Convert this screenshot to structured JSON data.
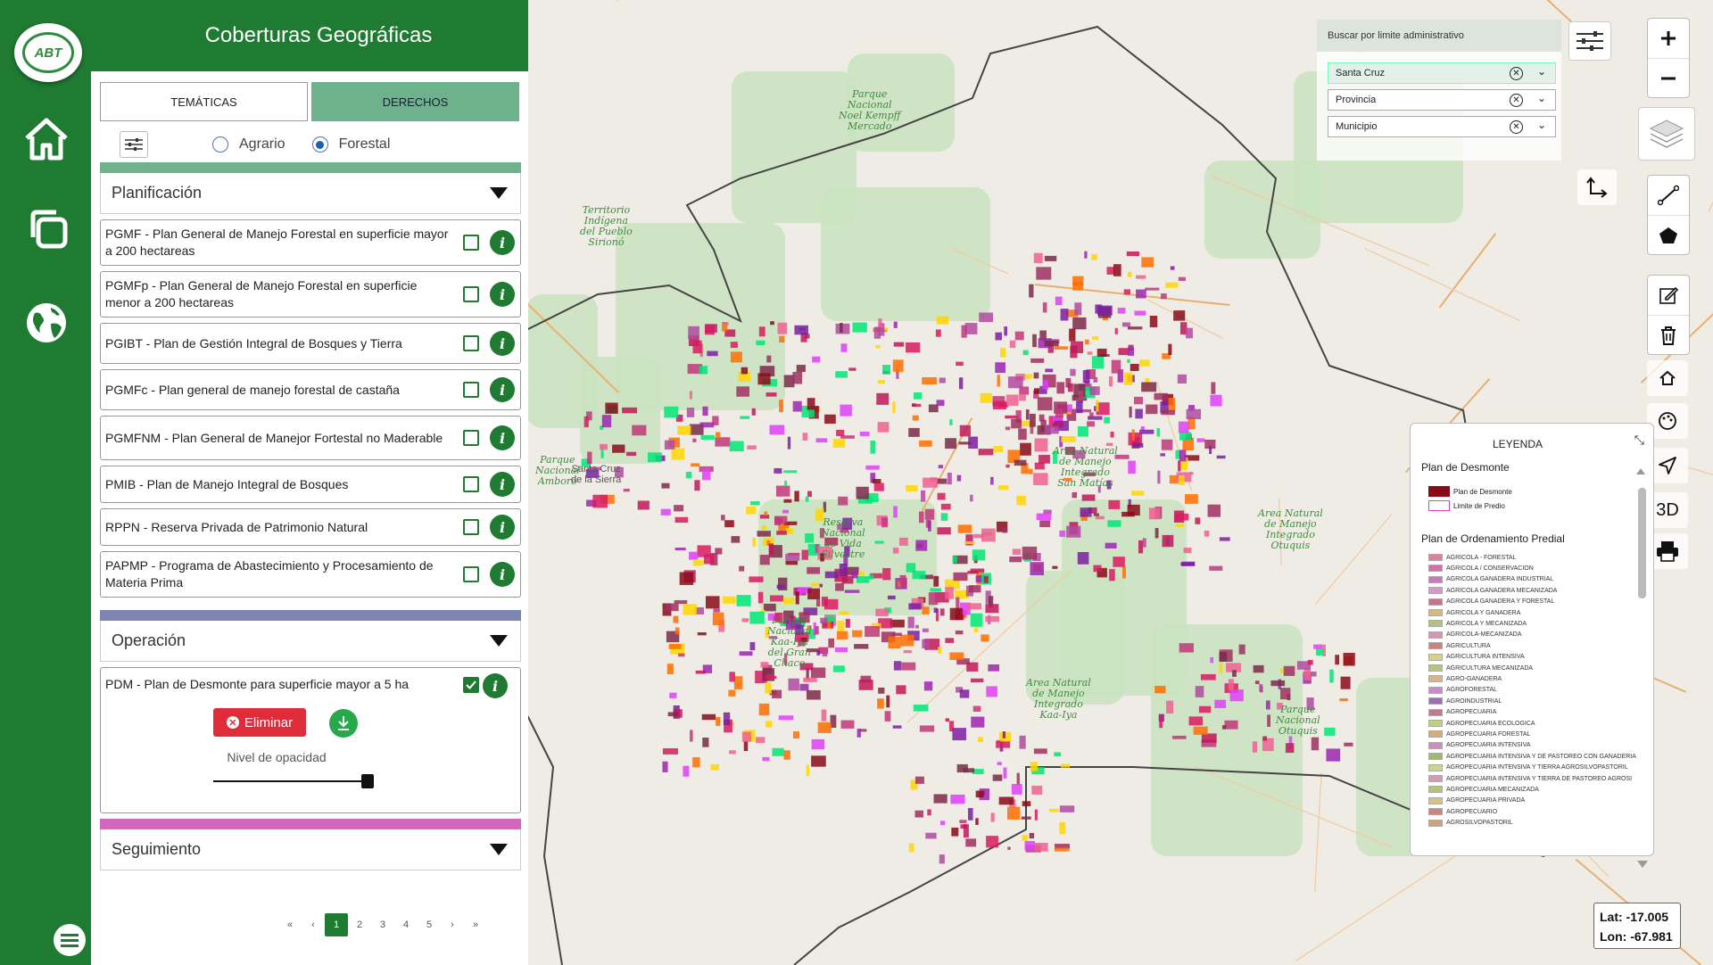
{
  "panel": {
    "title": "Coberturas Geográficas",
    "tabs": [
      "TEMÁTICAS",
      "DERECHOS"
    ],
    "radios": [
      {
        "label": "Agrario",
        "selected": false
      },
      {
        "label": "Forestal",
        "selected": true
      }
    ]
  },
  "logo": {
    "text": "ABT"
  },
  "sections": {
    "planificacion": {
      "title": "Planificación",
      "color": "#6db28a",
      "items": [
        "PGMF - Plan General de Manejo Forestal en superficie mayor a 200 hectareas",
        "PGMFp - Plan General de Manejo Forestal en superficie menor a 200 hectareas",
        "PGIBT - Plan de Gestión Integral de Bosques y Tierra",
        "PGMFc - Plan general de manejo forestal de castaña",
        "PGMFNM - Plan General de Manejor Fortestal no Maderable",
        "PMIB - Plan de Manejo Integral de Bosques",
        "RPPN - Reserva Privada de Patrimonio Natural",
        "PAPMP - Programa de Abastecimiento y Procesamiento de Materia Prima"
      ]
    },
    "operacion": {
      "title": "Operación",
      "color": "#7d86b3",
      "pdm": {
        "label": "PDM - Plan de Desmonte para superficie mayor a 5 ha",
        "checked": true,
        "delete_label": "Eliminar",
        "opacity_label": "Nivel de opacidad",
        "opacity": 1.0
      }
    },
    "seguimiento": {
      "title": "Seguimiento",
      "color": "#d466c0"
    }
  },
  "pager": {
    "pages": [
      "«",
      "‹",
      "1",
      "2",
      "3",
      "4",
      "5",
      "›",
      "»"
    ],
    "current": "1"
  },
  "admin": {
    "title": "Buscar por limite administrativo",
    "selects": [
      "Santa Cruz",
      "Provincia",
      "Municipio"
    ]
  },
  "controls": {
    "three_d": "3D"
  },
  "legend": {
    "title": "LEYENDA",
    "section1": "Plan de Desmonte",
    "items1": [
      {
        "label": "Plan de Desmonte",
        "color": "#8b0a1a"
      },
      {
        "label": "Limite de Predio",
        "color": "#ffffff",
        "border": "#e040c0"
      }
    ],
    "section2": "Plan de Ordenamiento Predial",
    "items2": [
      {
        "label": "AGRICOLA - FORESTAL",
        "color": "#d9849a"
      },
      {
        "label": "AGRICOLA / CONSERVACION",
        "color": "#d46fa8"
      },
      {
        "label": "AGRICOLA GANADERA INDUSTRIAL",
        "color": "#c97ab8"
      },
      {
        "label": "AGRICOLA GANADERA MECANIZADA",
        "color": "#d49acb"
      },
      {
        "label": "AGRICOLA GANADERA Y FORESTAL",
        "color": "#c7738a"
      },
      {
        "label": "AGRICOLA Y GANADERA",
        "color": "#d4b97a"
      },
      {
        "label": "AGRICOLA Y MECANIZADA",
        "color": "#b5c080"
      },
      {
        "label": "AGRICOLA-MECANIZADA",
        "color": "#d896b3"
      },
      {
        "label": "AGRICULTURA",
        "color": "#c9847f"
      },
      {
        "label": "AGRICULTURA INTENSIVA",
        "color": "#d6d28a"
      },
      {
        "label": "AGRICULTURA MECANIZADA",
        "color": "#b8c47a"
      },
      {
        "label": "AGRO-GANADERA",
        "color": "#d6b48c"
      },
      {
        "label": "AGROFORESTAL",
        "color": "#d08ac7"
      },
      {
        "label": "AGROINDUSTRIAL",
        "color": "#9d6fb0"
      },
      {
        "label": "AGROPECUARIA",
        "color": "#c27a93"
      },
      {
        "label": "AGROPECUARIA ECOLOGICA",
        "color": "#c4cf7a"
      },
      {
        "label": "AGROPECUARIA FORESTAL",
        "color": "#d4ad7d"
      },
      {
        "label": "AGROPECUARIA INTENSIVA",
        "color": "#cc8fb8"
      },
      {
        "label": "AGROPECUARIA INTENSIVA Y DE PASTOREO CON GANADERIA",
        "color": "#a4b86c"
      },
      {
        "label": "AGROPECUARIA INTENSIVA Y TIERRA AGROSILVOPASTORIL",
        "color": "#c9d68a"
      },
      {
        "label": "AGROPECUARIA INTENSIVA Y TIERRA DE PASTOREO AGROSI",
        "color": "#d49ab4"
      },
      {
        "label": "AGROPECUARIA MECANIZADA",
        "color": "#b9c177"
      },
      {
        "label": "AGROPECUARIA PRIVADA",
        "color": "#d4c28a"
      },
      {
        "label": "AGROPECUARIO",
        "color": "#c98780"
      },
      {
        "label": "AGROSILVOPASTORIL",
        "color": "#c9a680"
      }
    ]
  },
  "coords": {
    "lat": "Lat: -17.005",
    "lon": "Lon: -67.981"
  },
  "map_labels": [
    {
      "text": "Santa Cruz\nde la Sierra",
      "cls": "city"
    },
    {
      "text": "Parque\nNacional\nKaa-Iya\ndel Gran\nChaco",
      "cls": ""
    },
    {
      "text": "Area Natural\nde Manejo\nIntegrado\nSan Matías",
      "cls": ""
    },
    {
      "text": "Parque\nNacional\nNoel Kempff\nMercado",
      "cls": ""
    },
    {
      "text": "Territorio\nIndígena\ndel Pueblo\nSirionó",
      "cls": ""
    },
    {
      "text": "Area Natural\nde Manejo\nIntegrado\nOtuquis",
      "cls": ""
    },
    {
      "text": "Parque\nNacional\nOtuquis",
      "cls": ""
    },
    {
      "text": "Parque\nNacional\nAmboró",
      "cls": ""
    },
    {
      "text": "Reserva\nNacional\nde Vida\nSilvestre",
      "cls": ""
    },
    {
      "text": "Area Natural\nde Manejo\nIntegrado\nKaa-Iya",
      "cls": ""
    }
  ],
  "colors": {
    "brand": "#1f7a32",
    "accent": "#6db28a",
    "danger": "#e02b3b"
  }
}
